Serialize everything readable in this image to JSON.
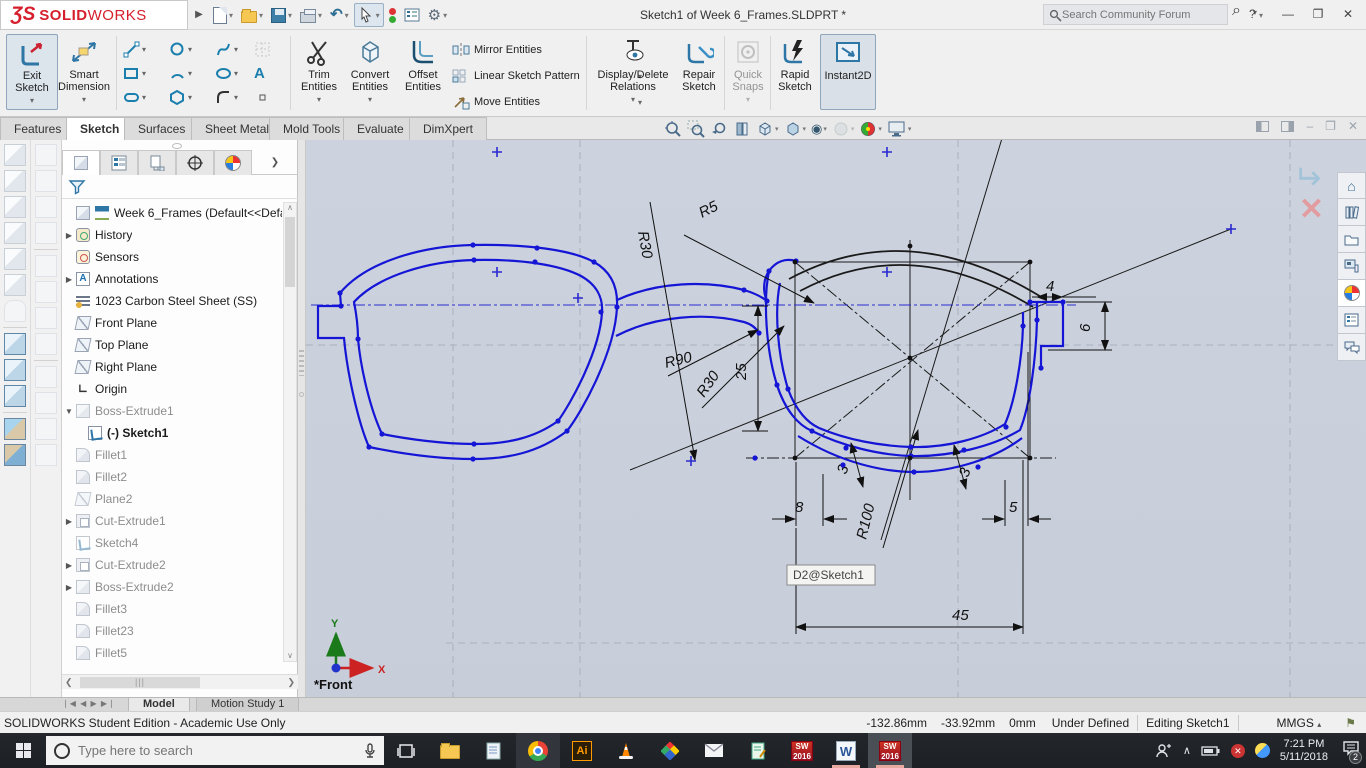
{
  "titlebar": {
    "logo_mark": "ƷS",
    "logo_solid": "SOLID",
    "logo_works": "WORKS",
    "title": "Sketch1 of Week 6_Frames.SLDPRT *",
    "search_placeholder": "Search Community Forum",
    "help": "?"
  },
  "ribbon": {
    "exit_sketch": "Exit Sketch",
    "smart_dimension": "Smart Dimension",
    "trim_entities": "Trim Entities",
    "convert_entities": "Convert Entities",
    "offset_entities": "Offset Entities",
    "mirror_entities": "Mirror Entities",
    "linear_sketch_pattern": "Linear Sketch Pattern",
    "move_entities": "Move Entities",
    "display_delete_relations": "Display/Delete Relations",
    "repair_sketch": "Repair Sketch",
    "quick_snaps": "Quick Snaps",
    "rapid_sketch": "Rapid Sketch",
    "instant2d": "Instant2D"
  },
  "tabs": [
    {
      "label": "Features"
    },
    {
      "label": "Sketch"
    },
    {
      "label": "Surfaces"
    },
    {
      "label": "Sheet Metal"
    },
    {
      "label": "Mold Tools"
    },
    {
      "label": "Evaluate"
    },
    {
      "label": "DimXpert"
    }
  ],
  "feature_tree": {
    "root": "Week 6_Frames  (Default<<Defa",
    "items": [
      {
        "label": "History"
      },
      {
        "label": "Sensors"
      },
      {
        "label": "Annotations"
      },
      {
        "label": "1023 Carbon Steel Sheet (SS)"
      },
      {
        "label": "Front Plane"
      },
      {
        "label": "Top Plane"
      },
      {
        "label": "Right Plane"
      },
      {
        "label": "Origin"
      },
      {
        "label": "Boss-Extrude1"
      },
      {
        "label": "(-) Sketch1"
      },
      {
        "label": "Fillet1"
      },
      {
        "label": "Fillet2"
      },
      {
        "label": "Plane2"
      },
      {
        "label": "Cut-Extrude1"
      },
      {
        "label": "Sketch4"
      },
      {
        "label": "Cut-Extrude2"
      },
      {
        "label": "Boss-Extrude2"
      },
      {
        "label": "Fillet3"
      },
      {
        "label": "Fillet23"
      },
      {
        "label": "Fillet5"
      }
    ]
  },
  "viewport": {
    "view_label": "*Front",
    "tooltip": "D2@Sketch1",
    "axis_x": "X",
    "axis_y": "Y",
    "dims": {
      "w45": "45",
      "w8": "8",
      "w5": "5",
      "h25": "25",
      "w4": "4",
      "h6": "6",
      "t3a": "3",
      "t3b": "3",
      "r5": "R5",
      "r30a": "R30",
      "r30b": "R30",
      "r90": "R90",
      "r100": "R100"
    }
  },
  "bottom_tabs": {
    "model": "Model",
    "motion_study": "Motion Study 1"
  },
  "statusbar": {
    "edition": "SOLIDWORKS Student Edition - Academic Use Only",
    "coord_x": "-132.86mm",
    "coord_y": "-33.92mm",
    "coord_z": "0mm",
    "define_state": "Under Defined",
    "editing": "Editing Sketch1",
    "units": "MMGS"
  },
  "taskbar": {
    "search_placeholder": "Type here to search",
    "time": "7:21 PM",
    "date": "5/11/2018",
    "notification_count": "2",
    "word_glyph": "W",
    "ai_glyph": "Ai",
    "sw_glyph": "SW",
    "sw_year": "2016"
  },
  "glyphs": {
    "annotation_a": "A",
    "text_a": "A",
    "home": "⌂"
  }
}
